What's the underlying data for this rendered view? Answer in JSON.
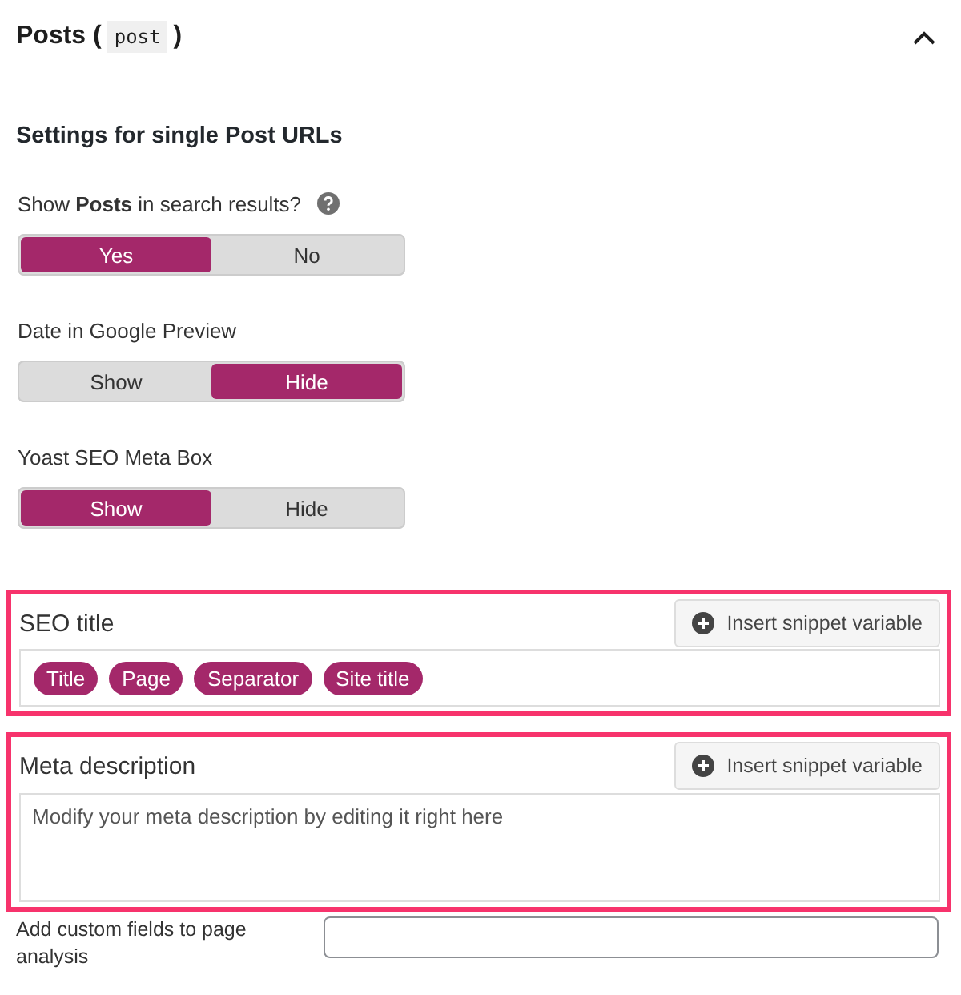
{
  "section": {
    "title": "Posts (",
    "code": "post",
    "title_end": ")",
    "expanded": true
  },
  "subheading": "Settings for single Post URLs",
  "toggles": [
    {
      "label": "Show **Posts** in search results?",
      "help": true,
      "options": [
        {
          "label": "Yes",
          "selected": true
        },
        {
          "label": "No",
          "selected": false
        }
      ]
    },
    {
      "label": "Date in Google Preview",
      "help": false,
      "options": [
        {
          "label": "Show",
          "selected": false
        },
        {
          "label": "Hide",
          "selected": true
        }
      ]
    },
    {
      "label": "Yoast SEO Meta Box",
      "help": false,
      "options": [
        {
          "label": "Show",
          "selected": true
        },
        {
          "label": "Hide",
          "selected": false
        }
      ]
    }
  ],
  "snippet_fields": [
    {
      "kind": "tags",
      "label": "SEO title",
      "button": "Insert snippet variable",
      "highlighted": true,
      "tags": [
        "Title",
        "Page",
        "Separator",
        "Site title"
      ]
    },
    {
      "kind": "textarea",
      "label": "Meta description",
      "button": "Insert snippet variable",
      "highlighted": true,
      "placeholder": "Modify your meta description by editing it right here"
    }
  ],
  "custom_fields": {
    "label": "Add custom fields to page analysis"
  }
}
